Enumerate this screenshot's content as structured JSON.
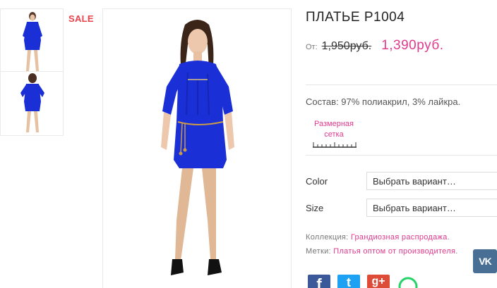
{
  "badge": {
    "sale": "SALE"
  },
  "product": {
    "title": "ПЛАТЬЕ P1004",
    "price_prefix": "От:",
    "old_price": "1,950руб.",
    "new_price": "1,390руб.",
    "composition": "Состав: 97% полиакрил, 3% лайкра.",
    "size_chart_line1": "Размерная",
    "size_chart_line2": "сетка"
  },
  "options": [
    {
      "label": "Color",
      "value": "Выбрать вариант…"
    },
    {
      "label": "Size",
      "value": "Выбрать вариант…"
    }
  ],
  "meta": {
    "collection_label": "Коллекция:",
    "collection_value": "Грандиозная распродажа",
    "tags_label": "Метки:",
    "tags_value": "Платья оптом от производителя"
  },
  "social": {
    "vk": "VK",
    "facebook": "f",
    "twitter": "t",
    "googleplus": "g+",
    "whatsapp": "whatsapp"
  },
  "colors": {
    "accent_pink": "#e03a8c",
    "sale_red": "#e8434b",
    "dress_blue": "#1b2fd6",
    "vk_blue": "#4a6f94",
    "facebook_blue": "#3b5998",
    "twitter_blue": "#1da1f2",
    "googleplus_red": "#dd4b39"
  }
}
